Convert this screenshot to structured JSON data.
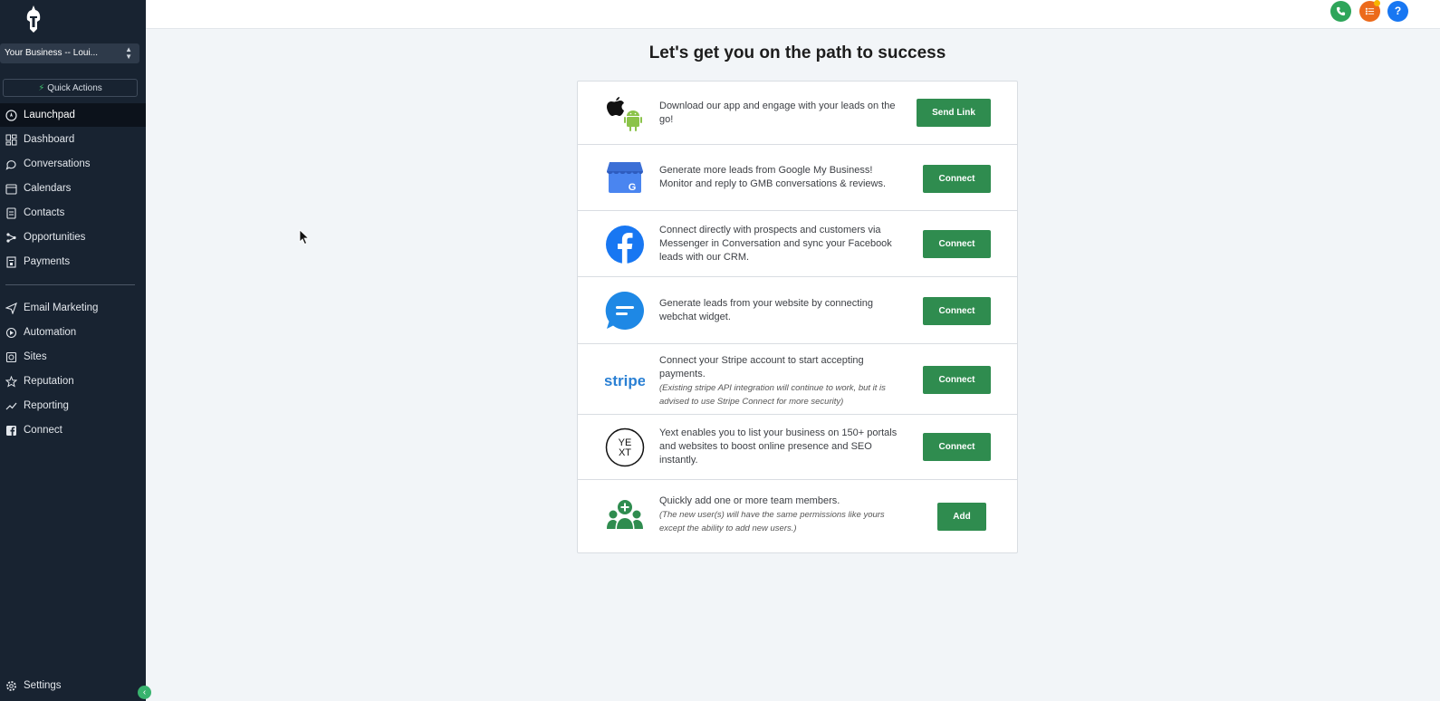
{
  "sidebar": {
    "business_selector": "Your Business -- Loui...",
    "quick_actions": "Quick Actions",
    "nav_main": [
      "Launchpad",
      "Dashboard",
      "Conversations",
      "Calendars",
      "Contacts",
      "Opportunities",
      "Payments"
    ],
    "nav_secondary": [
      "Email Marketing",
      "Automation",
      "Sites",
      "Reputation",
      "Reporting",
      "Connect"
    ],
    "settings": "Settings"
  },
  "header": {
    "help": "?"
  },
  "main": {
    "title": "Let's get you on the path to success",
    "rows": [
      {
        "text": "Download our app and engage with your leads on the go!",
        "note": "",
        "button": "Send Link"
      },
      {
        "text": "Generate more leads from Google My Business! Monitor and reply to GMB conversations & reviews.",
        "note": "",
        "button": "Connect"
      },
      {
        "text": "Connect directly with prospects and customers via Messenger in Conversation and sync your Facebook leads with our CRM.",
        "note": "",
        "button": "Connect"
      },
      {
        "text": "Generate leads from your website by connecting webchat widget.",
        "note": "",
        "button": "Connect"
      },
      {
        "text": "Connect your Stripe account to start accepting payments.",
        "note": "(Existing stripe API integration will continue to work, but it is advised to use Stripe Connect for more security)",
        "button": "Connect"
      },
      {
        "text": "Yext enables you to list your business on 150+ portals and websites to boost online presence and SEO instantly.",
        "note": "",
        "button": "Connect"
      },
      {
        "text": "Quickly add one or more team members.",
        "note": "(The new user(s) will have the same permissions like yours except the ability to add new users.)",
        "button": "Add"
      }
    ],
    "logos": {
      "stripe": "stripe",
      "yext": "YE XT"
    }
  },
  "colors": {
    "sidebar_bg": "#182331",
    "button_green": "#2f8c4f",
    "phone": "#2ea55a",
    "list": "#ec6a1b",
    "help": "#1877f2"
  }
}
